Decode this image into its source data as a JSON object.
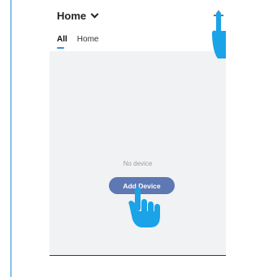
{
  "header": {
    "home_label": "Home",
    "tabs": [
      {
        "label": "All",
        "active": true
      },
      {
        "label": "Home",
        "active": false
      }
    ]
  },
  "empty_state": {
    "message": "No device",
    "add_button_label": "Add Device"
  },
  "colors": {
    "accent": "#5d78b3",
    "tab_indicator": "#3e8ae0",
    "pointer_hand": "#1ba3e8",
    "screen_background": "#f1f2f4"
  },
  "icons": [
    "chevron-down-icon",
    "plus-icon",
    "pointer-hand-icon"
  ]
}
